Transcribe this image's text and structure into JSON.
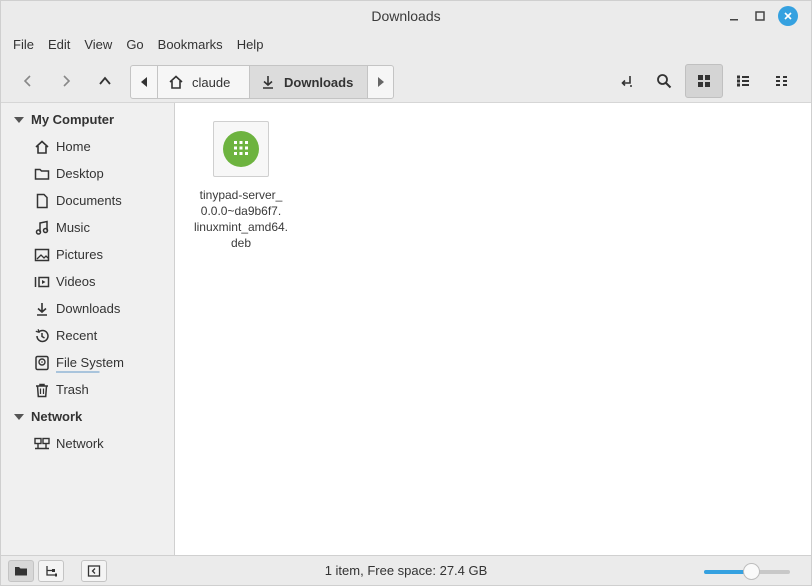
{
  "window": {
    "title": "Downloads"
  },
  "menu": [
    "File",
    "Edit",
    "View",
    "Go",
    "Bookmarks",
    "Help"
  ],
  "path": {
    "segments": [
      {
        "label": "claude",
        "icon": "home-icon"
      },
      {
        "label": "Downloads",
        "icon": "download-icon",
        "active": true
      }
    ]
  },
  "sidebar": {
    "sections": [
      {
        "title": "My Computer",
        "items": [
          {
            "label": "Home",
            "icon": "home-icon"
          },
          {
            "label": "Desktop",
            "icon": "folder-icon"
          },
          {
            "label": "Documents",
            "icon": "document-icon"
          },
          {
            "label": "Music",
            "icon": "music-icon"
          },
          {
            "label": "Pictures",
            "icon": "picture-icon"
          },
          {
            "label": "Videos",
            "icon": "video-icon"
          },
          {
            "label": "Downloads",
            "icon": "download-icon"
          },
          {
            "label": "Recent",
            "icon": "recent-icon"
          },
          {
            "label": "File System",
            "icon": "drive-icon",
            "usage_fraction": 0.62
          },
          {
            "label": "Trash",
            "icon": "trash-icon"
          }
        ]
      },
      {
        "title": "Network",
        "items": [
          {
            "label": "Network",
            "icon": "network-icon"
          }
        ]
      }
    ]
  },
  "files": [
    {
      "name": "tinypad-server_0.0.0~da9b6f7.linuxmint_amd64.deb",
      "name_lines": [
        "tinypad-server_",
        "0.0.0~da9b6f7.",
        "linuxmint_amd64.",
        "deb"
      ],
      "icon": "deb-package-icon"
    }
  ],
  "status": {
    "text": "1 item, Free space: 27.4 GB",
    "zoom_fraction": 0.55
  },
  "colors": {
    "accent": "#35a1e0",
    "package_green": "#6db33f"
  }
}
